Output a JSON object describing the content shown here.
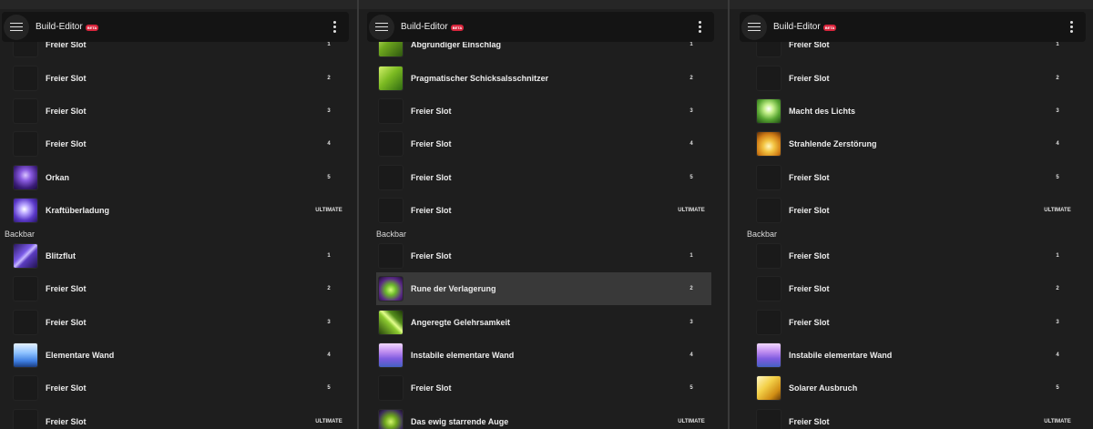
{
  "app": {
    "title": "Build-Editor",
    "badge": "BETA"
  },
  "section_label": "Backbar",
  "panels": [
    {
      "partial_top": {
        "name": "Freier Slot",
        "num": "1"
      },
      "front": [
        {
          "name": "Freier Slot",
          "num": "2",
          "icon": "empty-slot"
        },
        {
          "name": "Freier Slot",
          "num": "3",
          "icon": "empty-slot"
        },
        {
          "name": "Freier Slot",
          "num": "4",
          "icon": "empty-slot"
        },
        {
          "name": "Orkan",
          "num": "5",
          "icon": "hurricane-icon"
        },
        {
          "name": "Kraftüberladung",
          "num": "ULTIMATE",
          "icon": "overload-icon"
        }
      ],
      "back": [
        {
          "name": "Blitzflut",
          "num": "1",
          "icon": "lightning-flood-icon"
        },
        {
          "name": "Freier Slot",
          "num": "2",
          "icon": "empty-slot"
        },
        {
          "name": "Freier Slot",
          "num": "3",
          "icon": "empty-slot"
        },
        {
          "name": "Elementare Wand",
          "num": "4",
          "icon": "elemental-wall-icon"
        },
        {
          "name": "Freier Slot",
          "num": "5",
          "icon": "empty-slot"
        },
        {
          "name": "Freier Slot",
          "num": "ULTIMATE",
          "icon": "empty-slot"
        }
      ]
    },
    {
      "partial_top": {
        "name": "Abgrundiger Einschlag",
        "num": "1"
      },
      "front": [
        {
          "name": "Pragmatischer Schicksalsschnitzer",
          "num": "2",
          "icon": "fate-carver-icon"
        },
        {
          "name": "Freier Slot",
          "num": "3",
          "icon": "empty-slot"
        },
        {
          "name": "Freier Slot",
          "num": "4",
          "icon": "empty-slot"
        },
        {
          "name": "Freier Slot",
          "num": "5",
          "icon": "empty-slot"
        },
        {
          "name": "Freier Slot",
          "num": "ULTIMATE",
          "icon": "empty-slot"
        }
      ],
      "back": [
        {
          "name": "Freier Slot",
          "num": "1",
          "icon": "empty-slot"
        },
        {
          "name": "Rune der Verlagerung",
          "num": "2",
          "icon": "displacement-rune-icon",
          "highlighted": true
        },
        {
          "name": "Angeregte Gelehrsamkeit",
          "num": "3",
          "icon": "inspired-scholarship-icon"
        },
        {
          "name": "Instabile elementare Wand",
          "num": "4",
          "icon": "unstable-wall-icon"
        },
        {
          "name": "Freier Slot",
          "num": "5",
          "icon": "empty-slot"
        },
        {
          "name": "Das ewig starrende Auge",
          "num": "ULTIMATE",
          "icon": "staring-eye-icon"
        }
      ]
    },
    {
      "partial_top": {
        "name": "Freier Slot",
        "num": "1"
      },
      "front": [
        {
          "name": "Freier Slot",
          "num": "2",
          "icon": "empty-slot"
        },
        {
          "name": "Macht des Lichts",
          "num": "3",
          "icon": "power-of-light-icon"
        },
        {
          "name": "Strahlende Zerstörung",
          "num": "4",
          "icon": "radiant-destruction-icon"
        },
        {
          "name": "Freier Slot",
          "num": "5",
          "icon": "empty-slot"
        },
        {
          "name": "Freier Slot",
          "num": "ULTIMATE",
          "icon": "empty-slot"
        }
      ],
      "back": [
        {
          "name": "Freier Slot",
          "num": "1",
          "icon": "empty-slot"
        },
        {
          "name": "Freier Slot",
          "num": "2",
          "icon": "empty-slot"
        },
        {
          "name": "Freier Slot",
          "num": "3",
          "icon": "empty-slot"
        },
        {
          "name": "Instabile elementare Wand",
          "num": "4",
          "icon": "unstable-wall-icon"
        },
        {
          "name": "Solarer Ausbruch",
          "num": "5",
          "icon": "solar-burst-icon"
        },
        {
          "name": "Freier Slot",
          "num": "ULTIMATE",
          "icon": "empty-slot"
        }
      ]
    }
  ]
}
